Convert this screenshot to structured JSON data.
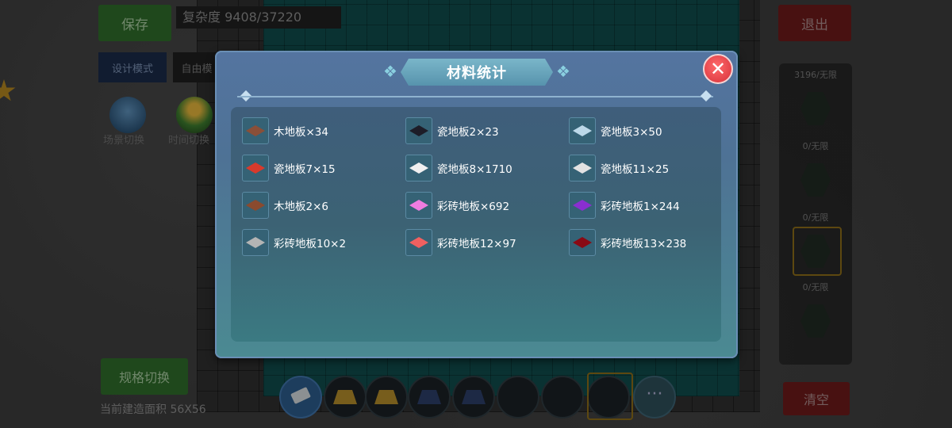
{
  "hud": {
    "save_label": "保存",
    "complexity_text": "复杂度 9408/37220",
    "mode_design": "设计模式",
    "mode_free": "自由模",
    "scene_switch": "场景切换",
    "time_switch": "时间切换",
    "spec_switch": "规格切换",
    "area_text": "当前建造面积 56X56",
    "exit_label": "退出",
    "clear_label": "清空",
    "side_counts": [
      "3196/无限",
      "0/无限",
      "0/无限",
      "0/无限"
    ]
  },
  "dialog": {
    "title": "材料统计",
    "close_glyph": "✕",
    "materials": [
      {
        "label": "木地板×34",
        "color": "#8a4f38"
      },
      {
        "label": "瓷地板2×23",
        "color": "#1d1d28"
      },
      {
        "label": "瓷地板3×50",
        "color": "#bcd8e8"
      },
      {
        "label": "瓷地板7×15",
        "color": "#d83a2c"
      },
      {
        "label": "瓷地板8×1710",
        "color": "#f0f0f0"
      },
      {
        "label": "瓷地板11×25",
        "color": "#e2e2e2"
      },
      {
        "label": "木地板2×6",
        "color": "#8a4a2e"
      },
      {
        "label": "彩砖地板×692",
        "color": "#f07ce0"
      },
      {
        "label": "彩砖地板1×244",
        "color": "#8a2fd0"
      },
      {
        "label": "彩砖地板10×2",
        "color": "#b4b4b4"
      },
      {
        "label": "彩砖地板12×97",
        "color": "#f06060"
      },
      {
        "label": "彩砖地板13×238",
        "color": "#8a0a14"
      }
    ]
  },
  "toolbar": {
    "more_glyph": "···"
  }
}
